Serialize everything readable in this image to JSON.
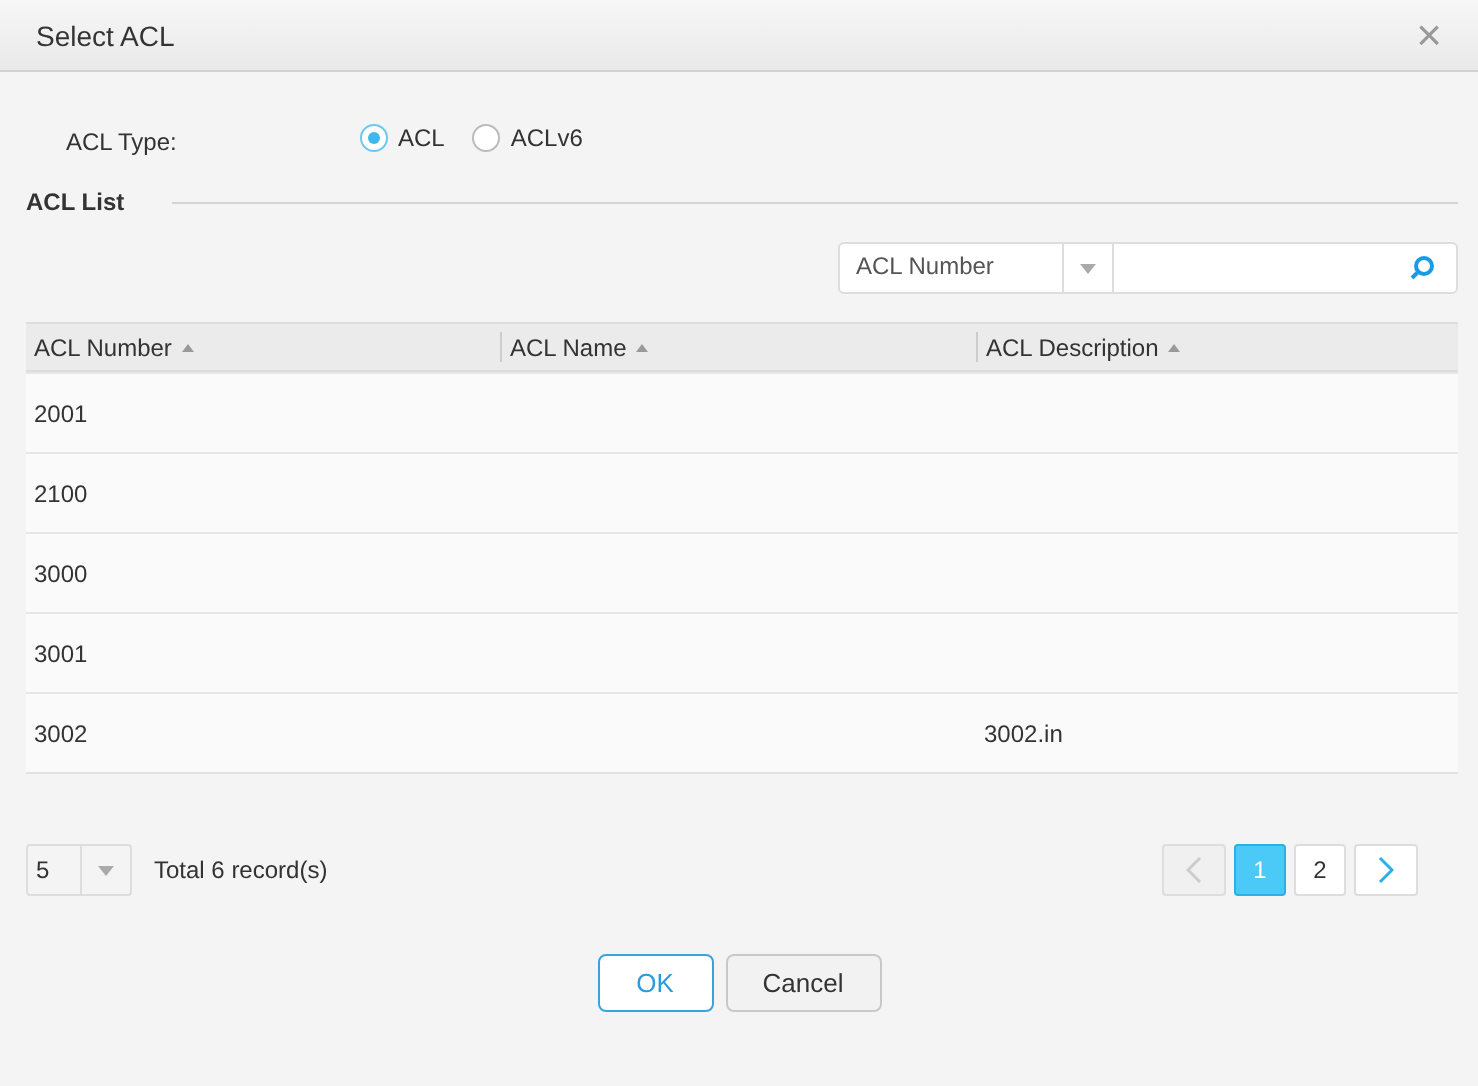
{
  "window": {
    "title": "Select ACL",
    "close": "×"
  },
  "acl_type": {
    "label": "ACL Type:",
    "options": [
      {
        "label": "ACL",
        "selected": true
      },
      {
        "label": "ACLv6",
        "selected": false
      }
    ]
  },
  "section_title": "ACL List",
  "search": {
    "field": "ACL Number"
  },
  "table": {
    "columns": [
      "ACL Number",
      "ACL Name",
      "ACL Description"
    ],
    "rows": [
      [
        "2001",
        "",
        ""
      ],
      [
        "2100",
        "",
        ""
      ],
      [
        "3000",
        "",
        ""
      ],
      [
        "3001",
        "",
        ""
      ],
      [
        "3002",
        "",
        "3002.in"
      ]
    ]
  },
  "pagination": {
    "page_size": "5",
    "total": "Total 6 record(s)",
    "prev_disabled": true,
    "next_disabled": false,
    "pages": [
      {
        "label": "1",
        "selected": true
      },
      {
        "label": "2",
        "selected": false
      }
    ]
  },
  "buttons": [
    {
      "label": "OK",
      "kind": "primary"
    },
    {
      "label": "Cancel",
      "kind": "secondary"
    }
  ]
}
